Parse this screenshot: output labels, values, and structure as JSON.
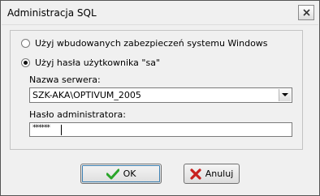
{
  "window": {
    "title": "Administracja SQL"
  },
  "auth": {
    "option_windows": "Użyj wbudowanych zabezpieczeń systemu Windows",
    "option_sa": "Użyj hasła użytkownika \"sa\"",
    "selected": "sa"
  },
  "server": {
    "label": "Nazwa serwera:",
    "value": "SZK-AKA\\OPTIVUM_2005"
  },
  "password": {
    "label": "Hasło administratora:",
    "masked_value": "******"
  },
  "buttons": {
    "ok": "OK",
    "cancel": "Anuluj"
  },
  "colors": {
    "ok_check": "#2aa52a",
    "cancel_x": "#c8201e"
  },
  "icons": {
    "ok": "checkmark-icon",
    "cancel": "red-x-icon",
    "close": "close-icon",
    "dropdown": "chevron-down-icon"
  }
}
